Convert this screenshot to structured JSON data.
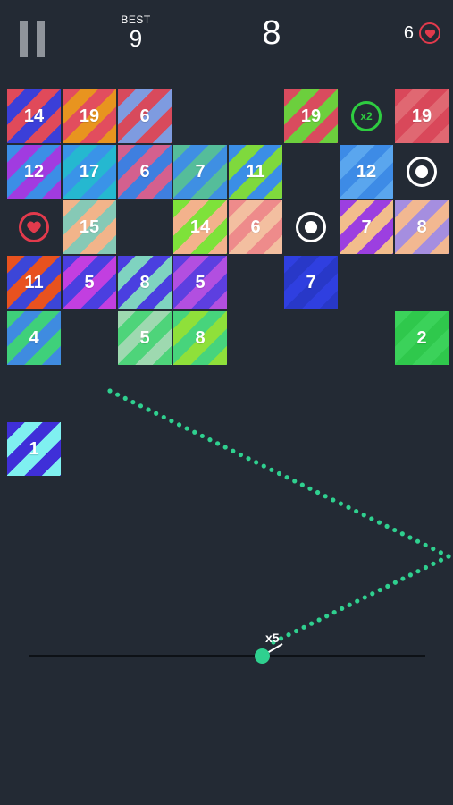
{
  "hud": {
    "best_label": "BEST",
    "best_value": "9",
    "score": "8",
    "lives": "6"
  },
  "launcher": {
    "ball_count": "x5"
  },
  "colors": {
    "background": "#232a34",
    "trail": "#2fd08f",
    "heart": "#e23a4c",
    "x2": "#2ecc40"
  },
  "tiles": [
    {
      "row": 0,
      "col": 0,
      "n": "14",
      "c1": "#e04a5a",
      "c2": "#3b3fd8"
    },
    {
      "row": 0,
      "col": 1,
      "n": "19",
      "c1": "#e24d5e",
      "c2": "#e8941f"
    },
    {
      "row": 0,
      "col": 2,
      "n": "6",
      "c1": "#d84a5c",
      "c2": "#7e9be0"
    },
    {
      "row": 0,
      "col": 5,
      "n": "19",
      "c1": "#d94b5e",
      "c2": "#6ccf3d"
    },
    {
      "row": 0,
      "col": 7,
      "n": "19",
      "c1": "#d9485a",
      "c2": "#e06872"
    },
    {
      "row": 1,
      "col": 0,
      "n": "12",
      "c1": "#3c8ee6",
      "c2": "#a13be0"
    },
    {
      "row": 1,
      "col": 1,
      "n": "17",
      "c1": "#3a93e8",
      "c2": "#25b8d0"
    },
    {
      "row": 1,
      "col": 2,
      "n": "6",
      "c1": "#d4608e",
      "c2": "#3f7fe0"
    },
    {
      "row": 1,
      "col": 3,
      "n": "7",
      "c1": "#55bd9a",
      "c2": "#3f8fe3"
    },
    {
      "row": 1,
      "col": 4,
      "n": "11",
      "c1": "#3b8ee6",
      "c2": "#7fd93d"
    },
    {
      "row": 1,
      "col": 6,
      "n": "12",
      "c1": "#3d8be6",
      "c2": "#5aa6ee"
    },
    {
      "row": 2,
      "col": 1,
      "n": "15",
      "c1": "#f2b48a",
      "c2": "#86c9b6"
    },
    {
      "row": 2,
      "col": 3,
      "n": "14",
      "c1": "#7ee23a",
      "c2": "#f3b28c"
    },
    {
      "row": 2,
      "col": 4,
      "n": "6",
      "c1": "#ee8b8b",
      "c2": "#f3bfa0"
    },
    {
      "row": 2,
      "col": 6,
      "n": "7",
      "c1": "#9c3fe0",
      "c2": "#f2bd8c"
    },
    {
      "row": 2,
      "col": 7,
      "n": "8",
      "c1": "#a58ee0",
      "c2": "#f2b891"
    },
    {
      "row": 3,
      "col": 0,
      "n": "11",
      "c1": "#e8521f",
      "c2": "#3c46d8"
    },
    {
      "row": 3,
      "col": 1,
      "n": "5",
      "c1": "#4a3fe0",
      "c2": "#c23fe0"
    },
    {
      "row": 3,
      "col": 2,
      "n": "8",
      "c1": "#4a3fe0",
      "c2": "#7fd3c0"
    },
    {
      "row": 3,
      "col": 3,
      "n": "5",
      "c1": "#5d3fe0",
      "c2": "#b24fe0"
    },
    {
      "row": 3,
      "col": 5,
      "n": "7",
      "c1": "#2f3fe0",
      "c2": "#2838c8"
    },
    {
      "row": 4,
      "col": 0,
      "n": "4",
      "c1": "#3fd07a",
      "c2": "#3f8be0"
    },
    {
      "row": 4,
      "col": 2,
      "n": "5",
      "c1": "#9ed9b0",
      "c2": "#4ed47a"
    },
    {
      "row": 4,
      "col": 3,
      "n": "8",
      "c1": "#47d47c",
      "c2": "#8fe03a"
    },
    {
      "row": 4,
      "col": 7,
      "n": "2",
      "c1": "#3bd25a",
      "c2": "#2fc84c"
    },
    {
      "row": 6,
      "col": 0,
      "n": "1",
      "c1": "#3f2fd8",
      "c2": "#7ff0f0"
    }
  ],
  "pickups": [
    {
      "row": 0,
      "col": 6,
      "type": "x2",
      "label": "x2"
    },
    {
      "row": 1,
      "col": 7,
      "type": "ring"
    },
    {
      "row": 2,
      "col": 0,
      "type": "heart"
    },
    {
      "row": 2,
      "col": 5,
      "type": "ring"
    }
  ]
}
